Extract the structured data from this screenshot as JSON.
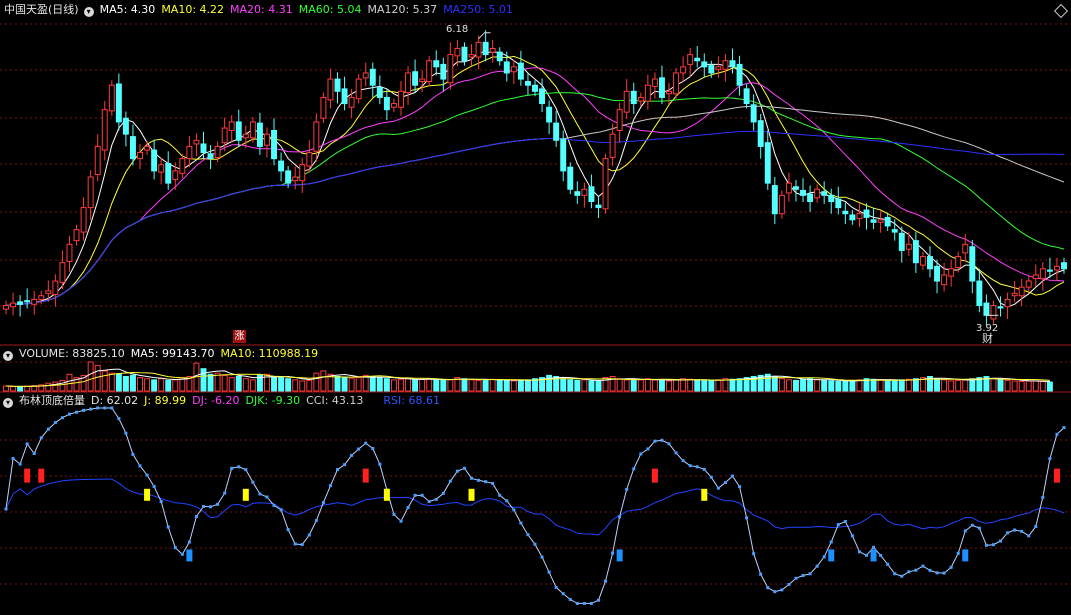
{
  "colors": {
    "up": "#ff3b3b",
    "down": "#54ffff",
    "ma5": "#ffffff",
    "ma10": "#ffff33",
    "ma20": "#ff40ff",
    "ma60": "#33ff33",
    "ma120": "#c8c8c8",
    "ma250": "#3030ff",
    "label": "#d0d0d0",
    "grid": "#7a1010",
    "sep": "#a01818",
    "ind_rsi": "#2244ff",
    "ind_main": "#bcd0ff",
    "ind_dot": "#4aa0ff",
    "mark_red": "#ff2020",
    "mark_yellow": "#ffff00",
    "mark_blue": "#1e90ff"
  },
  "header": {
    "title": "中国天盈(日线)",
    "ma5": "MA5: 4.30",
    "ma10": "MA10: 4.22",
    "ma20": "MA20: 4.31",
    "ma60": "MA60: 5.04",
    "ma120": "MA120: 5.37",
    "ma250": "MA250: 5.01"
  },
  "volume_header": {
    "title": "VOLUME: 83825.10",
    "ma5": "MA5: 99143.70",
    "ma10": "MA10: 110988.19"
  },
  "indicator_header": {
    "title": "布林顶底倍量",
    "d": "D: 62.02",
    "j": "J: 89.99",
    "dj": "DJ: -6.20",
    "djk": "DJK: -9.30",
    "cci": "CCI: 43.13",
    "rsi": "RSI: 68.61"
  },
  "annotations": {
    "high": "6.18",
    "low": "3.92",
    "zhang": "涨",
    "cai": "财"
  },
  "chart_data": [
    {
      "type": "candlestick",
      "price_range": [
        3.92,
        6.18
      ],
      "high_label": 6.18,
      "low_label": 3.92,
      "moving_averages": {
        "MA5": 4.3,
        "MA10": 4.22,
        "MA20": 4.31,
        "MA60": 5.04,
        "MA120": 5.37,
        "MA250": 5.01
      },
      "close": [
        4.0,
        4.02,
        4.01,
        4.03,
        4.05,
        4.08,
        4.12,
        4.2,
        4.35,
        4.5,
        4.62,
        4.8,
        5.05,
        5.3,
        5.6,
        5.8,
        5.5,
        5.4,
        5.2,
        5.25,
        5.3,
        5.1,
        5.15,
        5.0,
        5.1,
        5.2,
        5.3,
        5.35,
        5.25,
        5.2,
        5.3,
        5.45,
        5.5,
        5.35,
        5.4,
        5.5,
        5.3,
        5.4,
        5.2,
        5.1,
        5.0,
        5.05,
        5.15,
        5.25,
        5.5,
        5.7,
        5.85,
        5.75,
        5.65,
        5.7,
        5.85,
        5.9,
        5.8,
        5.7,
        5.6,
        5.65,
        5.75,
        5.9,
        5.8,
        5.85,
        6.0,
        5.95,
        5.85,
        6.05,
        6.1,
        6.0,
        6.05,
        6.15,
        6.05,
        6.1,
        6.0,
        5.9,
        5.95,
        5.85,
        5.8,
        5.75,
        5.65,
        5.5,
        5.35,
        5.1,
        4.95,
        4.9,
        4.95,
        4.85,
        4.8,
        5.2,
        5.4,
        5.6,
        5.75,
        5.65,
        5.7,
        5.8,
        5.85,
        5.7,
        5.75,
        5.9,
        5.95,
        6.05,
        6.0,
        5.95,
        5.9,
        5.95,
        6.0,
        5.95,
        5.8,
        5.65,
        5.5,
        5.3,
        5.0,
        4.75,
        4.9,
        5.0,
        4.95,
        4.9,
        4.85,
        4.95,
        4.9,
        4.85,
        4.8,
        4.75,
        4.7,
        4.75,
        4.72,
        4.68,
        4.7,
        4.65,
        4.6,
        4.45,
        4.5,
        4.35,
        4.4,
        4.3,
        4.2,
        4.25,
        4.3,
        4.4,
        4.5,
        4.2,
        4.0,
        3.92,
        4.0,
        3.98,
        4.05,
        4.1,
        4.15,
        4.2,
        4.25,
        4.3,
        4.28,
        4.32,
        4.3
      ],
      "volume": [
        45,
        40,
        38,
        42,
        48,
        55,
        70,
        80,
        95,
        150,
        120,
        140,
        260,
        230,
        180,
        160,
        150,
        130,
        140,
        120,
        110,
        100,
        110,
        95,
        100,
        120,
        130,
        250,
        200,
        150,
        160,
        140,
        120,
        130,
        110,
        100,
        140,
        150,
        130,
        120,
        110,
        100,
        90,
        95,
        160,
        180,
        150,
        130,
        120,
        115,
        120,
        140,
        130,
        120,
        110,
        100,
        105,
        110,
        100,
        105,
        110,
        100,
        95,
        100,
        120,
        110,
        100,
        95,
        100,
        105,
        100,
        95,
        90,
        95,
        100,
        110,
        120,
        140,
        130,
        110,
        100,
        95,
        100,
        90,
        85,
        120,
        130,
        110,
        100,
        95,
        100,
        110,
        100,
        95,
        90,
        100,
        110,
        105,
        95,
        90,
        95,
        100,
        110,
        105,
        110,
        120,
        130,
        140,
        150,
        130,
        110,
        100,
        95,
        105,
        110,
        100,
        95,
        90,
        85,
        90,
        95,
        100,
        110,
        105,
        100,
        95,
        90,
        100,
        105,
        110,
        120,
        130,
        110,
        100,
        90,
        95,
        100,
        110,
        120,
        130,
        110,
        100,
        95,
        90,
        85,
        88,
        90,
        85,
        80
      ]
    },
    {
      "type": "line",
      "series": [
        {
          "name": "D",
          "last": 62.02
        },
        {
          "name": "J",
          "last": 89.99
        },
        {
          "name": "DJ",
          "last": -6.2
        },
        {
          "name": "DJK",
          "last": -9.3
        },
        {
          "name": "CCI",
          "last": 43.13
        },
        {
          "name": "RSI",
          "last": 68.61
        }
      ]
    }
  ]
}
